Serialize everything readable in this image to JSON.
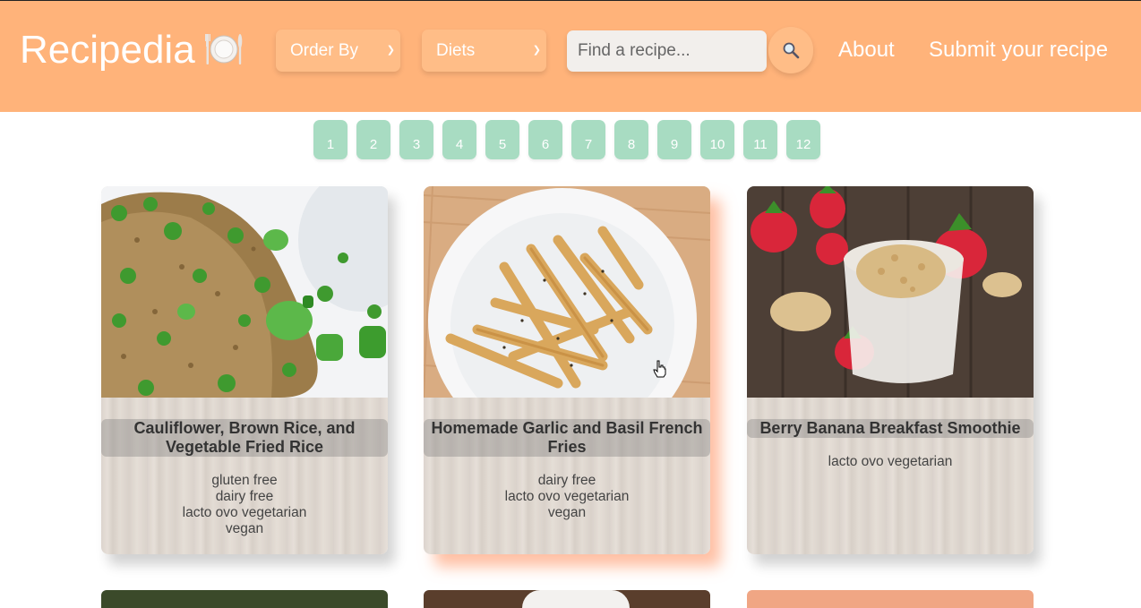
{
  "header": {
    "brand": "Recipedia",
    "brand_icon": "plate-cutlery-icon",
    "order_by_label": "Order By",
    "diets_label": "Diets",
    "search_placeholder": "Find a recipe...",
    "search_icon": "search-icon",
    "nav": [
      "About",
      "Submit your recipe"
    ],
    "colors": {
      "header": "#ffb37a",
      "page_button": "#a8dcc2",
      "hover_shadow": "#ff8c5a"
    }
  },
  "pagination": [
    "1",
    "2",
    "3",
    "4",
    "5",
    "6",
    "7",
    "8",
    "9",
    "10",
    "11",
    "12"
  ],
  "recipes": [
    {
      "title": "Cauliflower, Brown Rice, and Vegetable Fried Rice",
      "diets": [
        "gluten free",
        "dairy free",
        "lacto ovo vegetarian",
        "vegan"
      ],
      "image": "fried-rice-photo"
    },
    {
      "title": "Homemade Garlic and Basil French Fries",
      "diets": [
        "dairy free",
        "lacto ovo vegetarian",
        "vegan"
      ],
      "image": "french-fries-photo"
    },
    {
      "title": "Berry Banana Breakfast Smoothie",
      "diets": [
        "lacto ovo vegetarian"
      ],
      "image": "smoothie-photo"
    }
  ]
}
